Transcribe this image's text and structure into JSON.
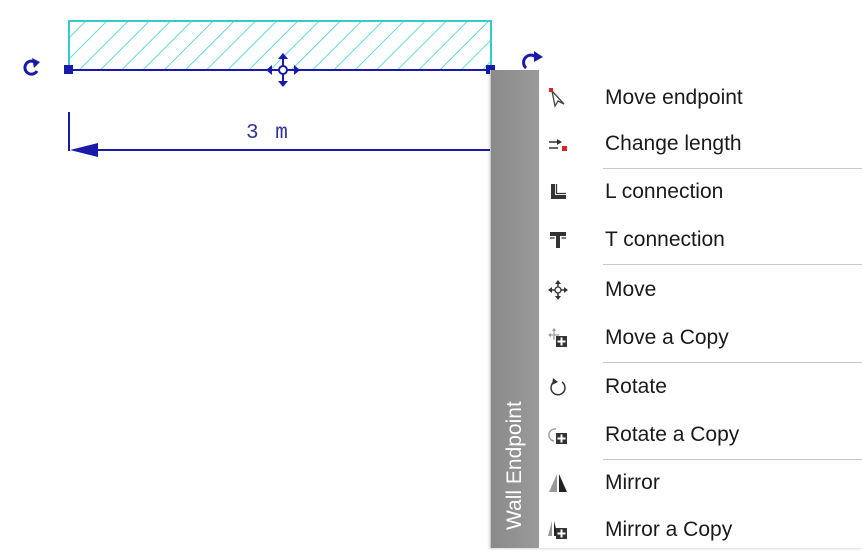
{
  "drawing": {
    "dimension_text": "3 m"
  },
  "menu": {
    "title": "Wall Endpoint",
    "items": [
      {
        "label": "Move endpoint",
        "icon": "move-endpoint-icon"
      },
      {
        "label": "Change length",
        "icon": "change-length-icon"
      },
      {
        "label": "L connection",
        "icon": "l-connection-icon"
      },
      {
        "label": "T connection",
        "icon": "t-connection-icon"
      },
      {
        "label": "Move",
        "icon": "move-icon"
      },
      {
        "label": "Move a Copy",
        "icon": "move-copy-icon"
      },
      {
        "label": "Rotate",
        "icon": "rotate-icon"
      },
      {
        "label": "Rotate a Copy",
        "icon": "rotate-copy-icon"
      },
      {
        "label": "Mirror",
        "icon": "mirror-icon"
      },
      {
        "label": "Mirror a Copy",
        "icon": "mirror-copy-icon"
      }
    ]
  },
  "colors": {
    "wall_outline": "#33cccc",
    "wall_hatch": "#66d9d9",
    "dimension": "#1a1aa8",
    "menu_side": "#8e8e8e"
  }
}
